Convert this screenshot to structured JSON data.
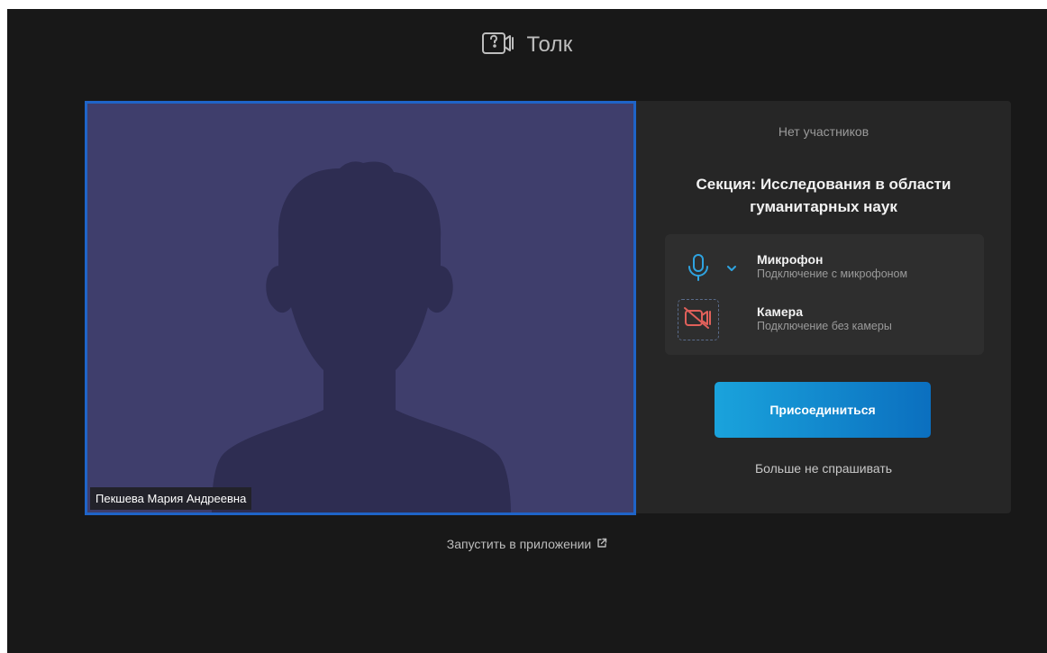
{
  "header": {
    "app_name": "Толк",
    "logo_icon": "video-camera-icon"
  },
  "video": {
    "participant_name": "Пекшева Мария Андреевна",
    "background_color": "#3f3e6c",
    "border_color": "#1f64c8"
  },
  "panel": {
    "participants_status": "Нет участников",
    "section_title": "Секция: Исследования в области гуманитарных наук",
    "devices": {
      "microphone": {
        "title": "Микрофон",
        "subtitle": "Подключение с микрофоном",
        "icon": "microphone-icon"
      },
      "camera": {
        "title": "Камера",
        "subtitle": "Подключение без камеры",
        "icon": "camera-off-icon"
      }
    },
    "join_label": "Присоединиться",
    "dont_ask_label": "Больше не спрашивать"
  },
  "footer": {
    "launch_app_label": "Запустить в приложении",
    "launch_icon": "external-link-icon"
  },
  "colors": {
    "app_background": "#181818",
    "panel_background": "#262626",
    "accent_start": "#1aa3dc",
    "accent_end": "#0b6fbf",
    "camera_off": "#e0605a"
  }
}
